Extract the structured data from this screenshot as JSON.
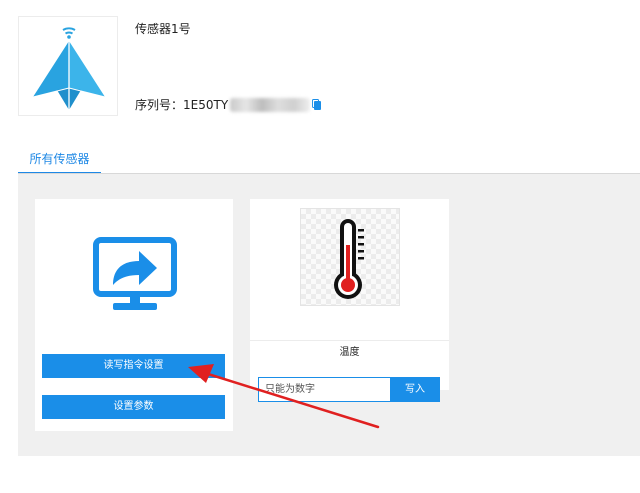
{
  "device": {
    "name": "传感器1号",
    "serial_label": "序列号：",
    "serial_value": "1E50TY"
  },
  "tabs": [
    {
      "label": "所有传感器",
      "active": true
    }
  ],
  "cards": {
    "command": {
      "icon": "screen-share-icon",
      "read_write_label": "读写指令设置",
      "settings_label": "设置参数"
    },
    "sensor": {
      "icon": "thermometer-icon",
      "title": "温度",
      "input_placeholder": "只能为数字",
      "input_value": "",
      "write_label": "写入"
    }
  },
  "colors": {
    "accent": "#1a8ee8",
    "logo": "#29a3e0",
    "arrow": "#e02020",
    "panel_bg": "#f0f0f0"
  }
}
